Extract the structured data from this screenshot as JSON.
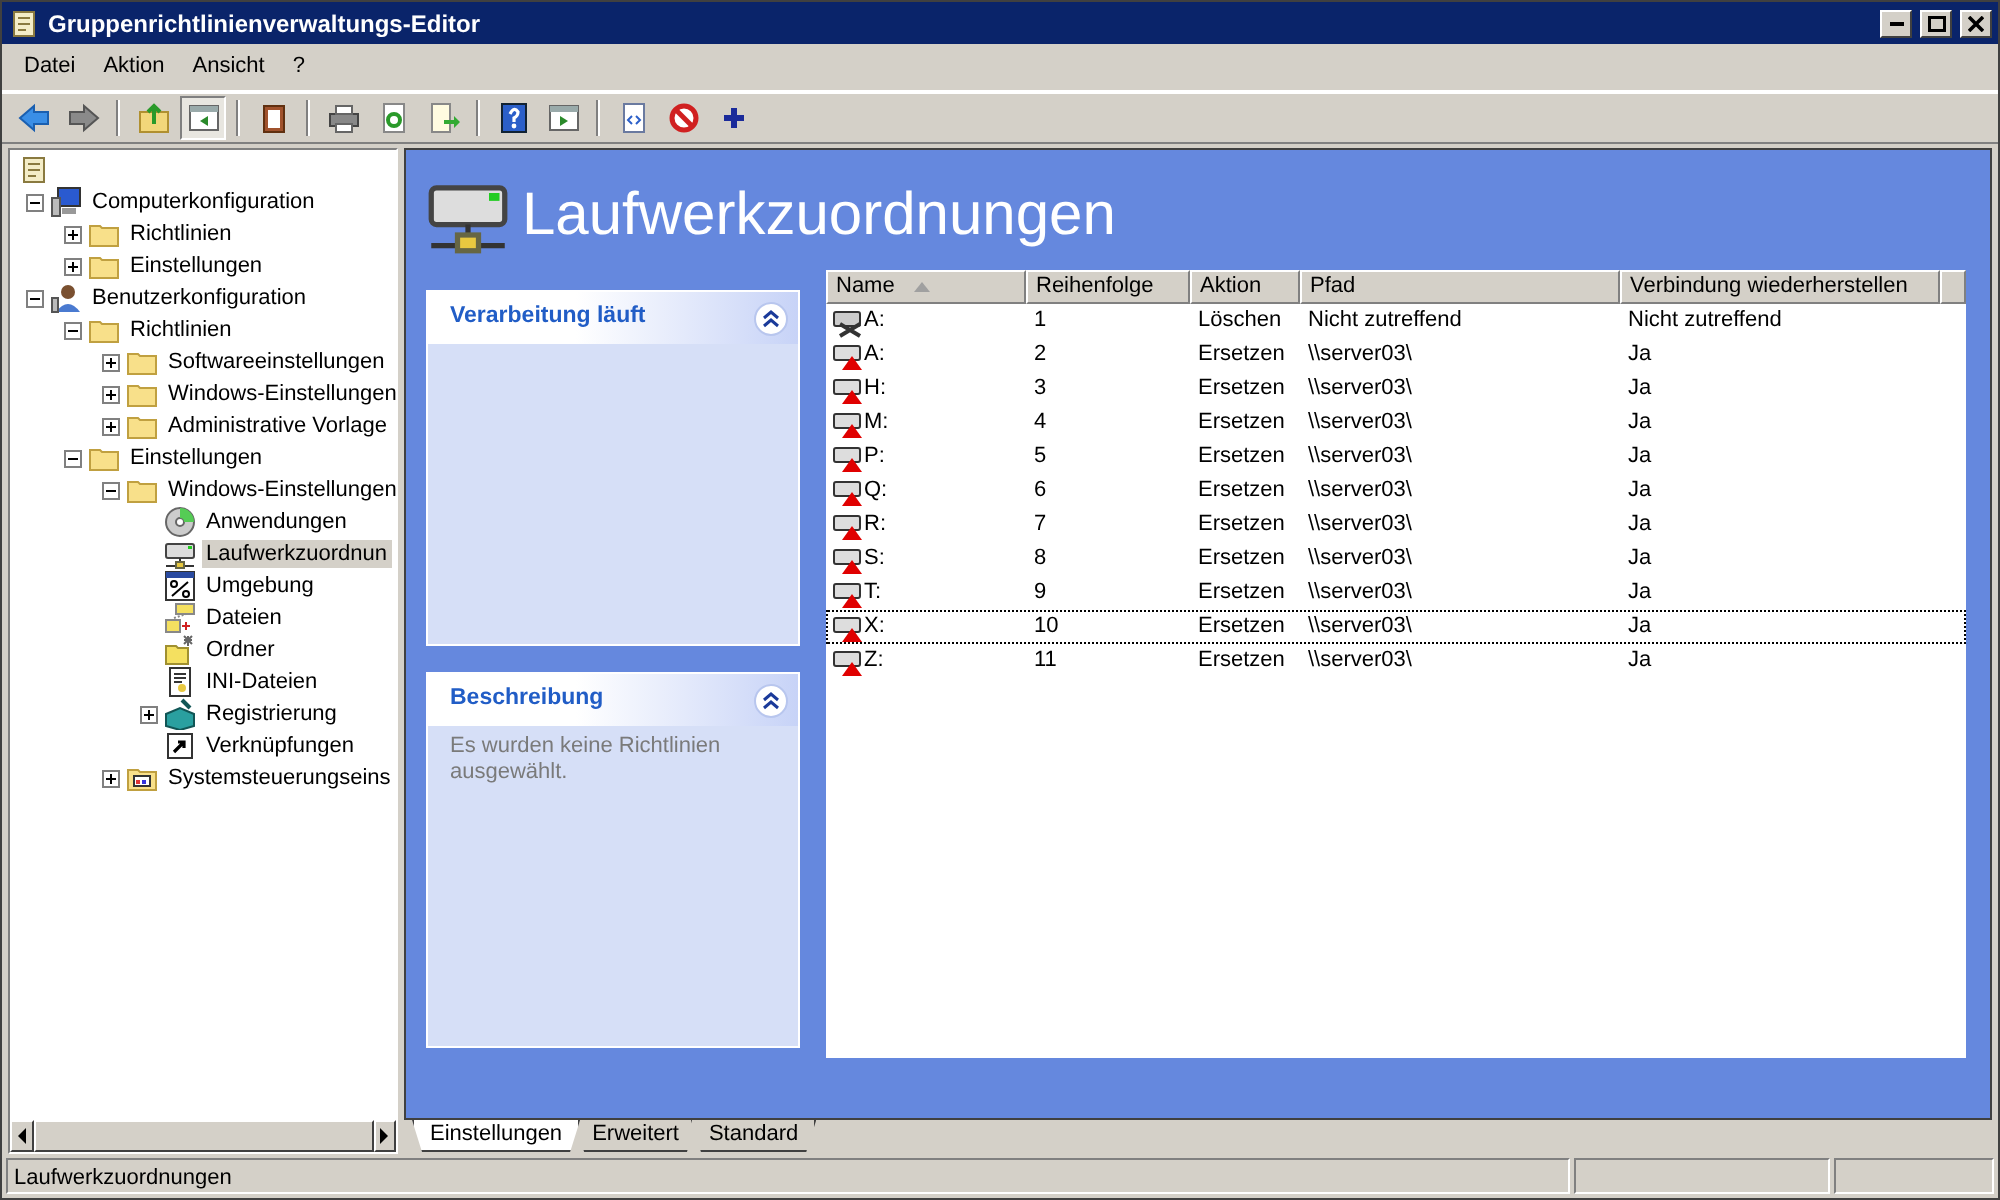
{
  "window": {
    "title": "Gruppenrichtlinienverwaltungs-Editor"
  },
  "menu": [
    {
      "label": "Datei"
    },
    {
      "label": "Aktion"
    },
    {
      "label": "Ansicht"
    },
    {
      "label": "?"
    }
  ],
  "toolbar": [
    {
      "kind": "back",
      "pressed": false
    },
    {
      "kind": "forward",
      "pressed": false
    },
    {
      "kind": "separator"
    },
    {
      "kind": "up",
      "pressed": false
    },
    {
      "kind": "tree",
      "pressed": true
    },
    {
      "kind": "separator"
    },
    {
      "kind": "clipboard",
      "pressed": false
    },
    {
      "kind": "separator"
    },
    {
      "kind": "print",
      "pressed": false
    },
    {
      "kind": "refresh",
      "pressed": false
    },
    {
      "kind": "export",
      "pressed": false
    },
    {
      "kind": "separator"
    },
    {
      "kind": "help",
      "pressed": false
    },
    {
      "kind": "panel",
      "pressed": false
    },
    {
      "kind": "separator"
    },
    {
      "kind": "doc",
      "pressed": false
    },
    {
      "kind": "stop",
      "pressed": false
    },
    {
      "kind": "plus",
      "pressed": false
    }
  ],
  "tree": {
    "kind": "scroll",
    "children": [
      {
        "label": "Computerkonfiguration",
        "kind": "computer",
        "expanded": true,
        "selected": false,
        "children": [
          {
            "label": "Richtlinien",
            "kind": "folder",
            "expanded": false,
            "selected": false
          },
          {
            "label": "Einstellungen",
            "kind": "folder",
            "expanded": false,
            "selected": false
          }
        ]
      },
      {
        "label": "Benutzerkonfiguration",
        "kind": "user",
        "expanded": true,
        "selected": false,
        "children": [
          {
            "label": "Richtlinien",
            "kind": "folder",
            "expanded": true,
            "selected": false,
            "children": [
              {
                "label": "Softwareeinstellungen",
                "kind": "folder",
                "expanded": false,
                "selected": false
              },
              {
                "label": "Windows-Einstellungen",
                "kind": "folder",
                "expanded": false,
                "selected": false
              },
              {
                "label": "Administrative Vorlage",
                "kind": "folder",
                "expanded": false,
                "selected": false
              }
            ]
          },
          {
            "label": "Einstellungen",
            "kind": "folder",
            "expanded": true,
            "selected": false,
            "children": [
              {
                "label": "Windows-Einstellungen",
                "kind": "folder",
                "expanded": true,
                "selected": false,
                "children": [
                  {
                    "label": "Anwendungen",
                    "kind": "cd",
                    "selected": false
                  },
                  {
                    "label": "Laufwerkzuordnun",
                    "kind": "drive",
                    "selected": true
                  },
                  {
                    "label": "Umgebung",
                    "kind": "percent",
                    "selected": false
                  },
                  {
                    "label": "Dateien",
                    "kind": "files",
                    "selected": false
                  },
                  {
                    "label": "Ordner",
                    "kind": "newfolder",
                    "selected": false
                  },
                  {
                    "label": "INI-Dateien",
                    "kind": "ini",
                    "selected": false
                  },
                  {
                    "label": "Registrierung",
                    "kind": "registry",
                    "expanded": false,
                    "selected": false
                  },
                  {
                    "label": "Verknüpfungen",
                    "kind": "shortcut",
                    "selected": false
                  }
                ]
              },
              {
                "label": "Systemsteuerungseins",
                "kind": "control",
                "expanded": false,
                "selected": false
              }
            ]
          }
        ]
      }
    ]
  },
  "header": {
    "title": "Laufwerkzuordnungen"
  },
  "panels": [
    {
      "title": "Verarbeitung läuft",
      "expanded": true
    },
    {
      "title": "Beschreibung",
      "expanded": true,
      "text": "Es wurden keine Richtlinien ausgewählt."
    }
  ],
  "table": {
    "columns": [
      {
        "label": "Name",
        "sorted": true
      },
      {
        "label": "Reihenfolge",
        "sorted": false
      },
      {
        "label": "Aktion",
        "sorted": false
      },
      {
        "label": "Pfad",
        "sorted": false
      },
      {
        "label": "Verbindung wiederherstellen",
        "sorted": false
      }
    ],
    "rows": [
      {
        "kind": "delete",
        "focused": false,
        "cells": [
          "A:",
          "1",
          "Löschen",
          "Nicht zutreffend",
          "Nicht zutreffend"
        ]
      },
      {
        "kind": "replace",
        "focused": false,
        "cells": [
          "A:",
          "2",
          "Ersetzen",
          "\\\\server03\\",
          "Ja"
        ]
      },
      {
        "kind": "replace",
        "focused": false,
        "cells": [
          "H:",
          "3",
          "Ersetzen",
          "\\\\server03\\",
          "Ja"
        ]
      },
      {
        "kind": "replace",
        "focused": false,
        "cells": [
          "M:",
          "4",
          "Ersetzen",
          "\\\\server03\\",
          "Ja"
        ]
      },
      {
        "kind": "replace",
        "focused": false,
        "cells": [
          "P:",
          "5",
          "Ersetzen",
          "\\\\server03\\",
          "Ja"
        ]
      },
      {
        "kind": "replace",
        "focused": false,
        "cells": [
          "Q:",
          "6",
          "Ersetzen",
          "\\\\server03\\",
          "Ja"
        ]
      },
      {
        "kind": "replace",
        "focused": false,
        "cells": [
          "R:",
          "7",
          "Ersetzen",
          "\\\\server03\\",
          "Ja"
        ]
      },
      {
        "kind": "replace",
        "focused": false,
        "cells": [
          "S:",
          "8",
          "Ersetzen",
          "\\\\server03\\",
          "Ja"
        ]
      },
      {
        "kind": "replace",
        "focused": false,
        "cells": [
          "T:",
          "9",
          "Ersetzen",
          "\\\\server03\\",
          "Ja"
        ]
      },
      {
        "kind": "replace",
        "focused": true,
        "cells": [
          "X:",
          "10",
          "Ersetzen",
          "\\\\server03\\",
          "Ja"
        ]
      },
      {
        "kind": "replace",
        "focused": false,
        "cells": [
          "Z:",
          "11",
          "Ersetzen",
          "\\\\server03\\",
          "Ja"
        ]
      }
    ]
  },
  "tabs": [
    {
      "label": "Einstellungen",
      "selected": true
    },
    {
      "label": "Erweitert",
      "selected": false
    },
    {
      "label": "Standard",
      "selected": false
    }
  ],
  "status_bar": {
    "text": "Laufwerkzuordnungen"
  }
}
